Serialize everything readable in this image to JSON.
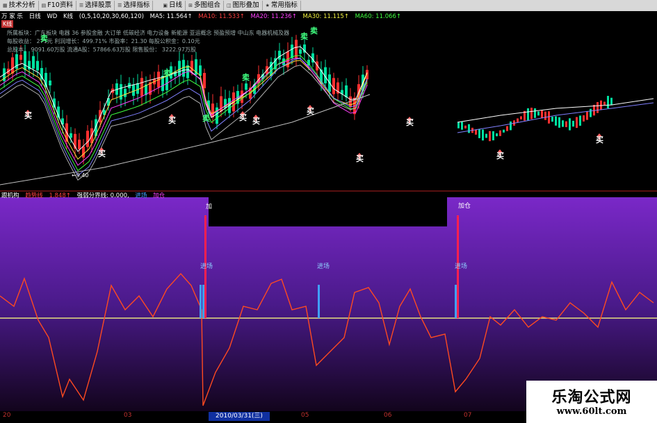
{
  "toolbar": {
    "buttons": [
      {
        "label": "技术分析",
        "icon": "chart-icon"
      },
      {
        "label": "F10资料",
        "icon": "doc-icon"
      },
      {
        "label": "选择股票",
        "icon": "list-icon"
      },
      {
        "label": "选择指标",
        "icon": "list-icon"
      },
      {
        "label": "日线",
        "icon": "calendar-icon"
      },
      {
        "label": "多图组合",
        "icon": "grid-icon"
      },
      {
        "label": "图形叠加",
        "icon": "overlay-icon"
      },
      {
        "label": "常用指标",
        "icon": "star-icon"
      }
    ]
  },
  "chart_header": {
    "brand": "万 家 乐",
    "period": "日线",
    "mode": "WD",
    "kline": "K线",
    "ma_params": "(0,5,10,20,30,60,120)",
    "ma5": "MA5: 11.564↑",
    "ma10": "MA10: 11.533↑",
    "ma20": "MA20: 11.236↑",
    "ma30": "MA30: 11.115↑",
    "ma60": "MA60: 11.066↑",
    "kline_tag": "K线"
  },
  "stock_info": {
    "line1": "所属板块：广东板块 电器 36 参股金融 大订单 低碳经济 电力设备 新能源 亚运概念 预盈预增 中山东 电器机械及器",
    "line2": "每股收益：     271元       利润增长：499.71%     市盈率：21.30       每股公积金：0.10元",
    "line3": "总股本：  9091.60万股    流通A股：57866.63万股   限售股份：  3222.97万股"
  },
  "chart_marks": {
    "buy": "买",
    "sell": "卖",
    "low_price": "9.40"
  },
  "indicator": {
    "name": "跟机构",
    "line_name": "趋势线",
    "line_value": "1.848↑",
    "threshold_label": "强弱分界线: 0.000,",
    "entry_label": "进场",
    "add_label": "加仓"
  },
  "signals": {
    "entry": "进场",
    "add": "加仓"
  },
  "date_axis": {
    "ticks": [
      "20",
      "03",
      "05",
      "06",
      "07"
    ],
    "current": "2010/03/31(三)"
  },
  "watermark": {
    "name": "乐淘公式网",
    "url": "www.60lt.com"
  },
  "colors": {
    "up_candle": "#ff3030",
    "down_candle": "#00e0a0",
    "trend_line": "#ff4a20",
    "threshold_line": "#e8e080",
    "entry_bar": "#40a0ff",
    "add_bar": "#ff2050",
    "panel_top": "#7a28c8",
    "panel_bottom": "#12041c"
  }
}
